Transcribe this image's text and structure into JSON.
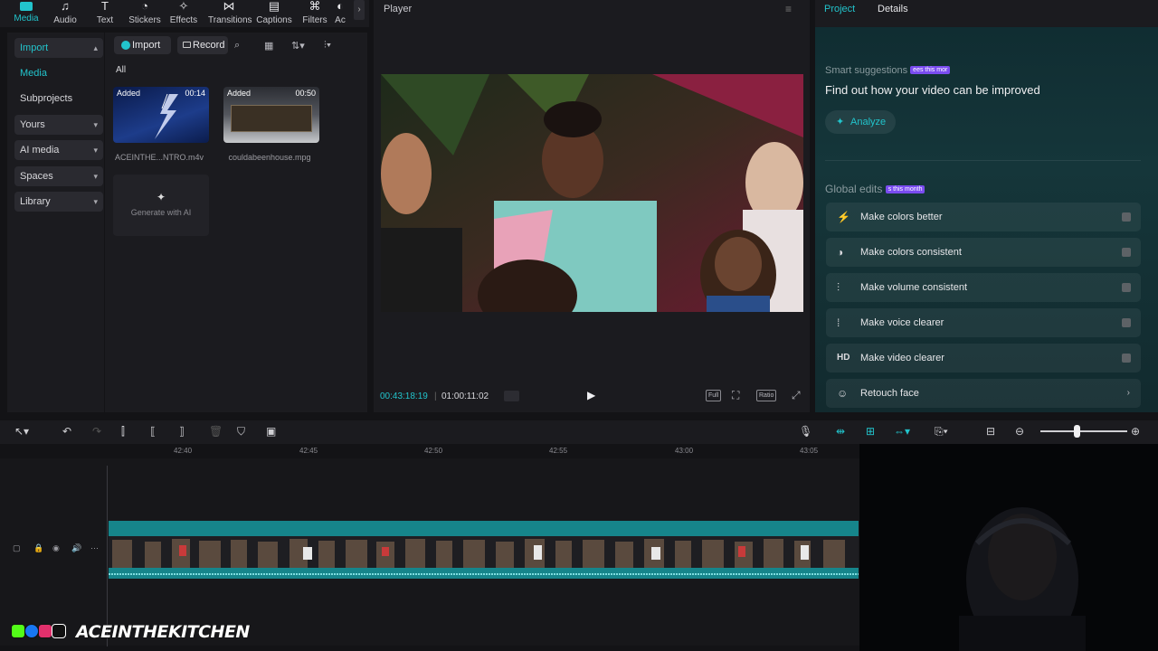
{
  "toolbar": {
    "tabs": [
      {
        "label": "Media",
        "icon": "media-icon",
        "active": true
      },
      {
        "label": "Audio",
        "icon": "audio-icon"
      },
      {
        "label": "Text",
        "icon": "text-icon"
      },
      {
        "label": "Stickers",
        "icon": "stickers-icon"
      },
      {
        "label": "Effects",
        "icon": "effects-icon"
      },
      {
        "label": "Transitions",
        "icon": "transitions-icon"
      },
      {
        "label": "Captions",
        "icon": "captions-icon"
      },
      {
        "label": "Filters",
        "icon": "filters-icon"
      },
      {
        "label": "Ac",
        "icon": "adjust-icon"
      }
    ]
  },
  "leftnav": {
    "import": "Import",
    "media": "Media",
    "subprojects": "Subprojects",
    "yours": "Yours",
    "ai_media": "AI media",
    "spaces": "Spaces",
    "library": "Library"
  },
  "media": {
    "import_btn": "Import",
    "record_btn": "Record",
    "filter_all": "All",
    "items": [
      {
        "tag": "Added",
        "duration": "00:14",
        "name": "ACEINTHE...NTRO.m4v"
      },
      {
        "tag": "Added",
        "duration": "00:50",
        "name": "couldabeenhouse.mpg"
      }
    ],
    "generate": "Generate with AI"
  },
  "player": {
    "title": "Player",
    "current_time": "00:43:18:19",
    "total_time": "01:00:11:02",
    "full_btn": "Full",
    "ratio_btn": "Ratio"
  },
  "rightpanel": {
    "tab_project": "Project",
    "tab_details": "Details",
    "smart_title": "Smart suggestions",
    "smart_badge": "ees this mor",
    "smart_heading": "Find out how your video can be improved",
    "analyze": "Analyze",
    "global_title": "Global edits",
    "global_badge": "s this month",
    "actions": [
      {
        "label": "Make colors better",
        "icon": "magic-wand-icon"
      },
      {
        "label": "Make colors consistent",
        "icon": "color-match-icon"
      },
      {
        "label": "Make volume consistent",
        "icon": "sliders-icon"
      },
      {
        "label": "Make voice clearer",
        "icon": "waveform-icon"
      },
      {
        "label": "Make video clearer",
        "icon": "hd-icon",
        "icon_text": "HD"
      },
      {
        "label": "Retouch face",
        "icon": "face-icon"
      }
    ]
  },
  "timeline": {
    "ticks": [
      "42:40",
      "42:45",
      "42:50",
      "42:55",
      "43:00",
      "43:05"
    ]
  },
  "watermark": {
    "text": "ACEINTHEKITCHEN"
  },
  "colors": {
    "accent": "#22c4cc",
    "badge": "#7a4cf0",
    "clip": "#16858b"
  }
}
